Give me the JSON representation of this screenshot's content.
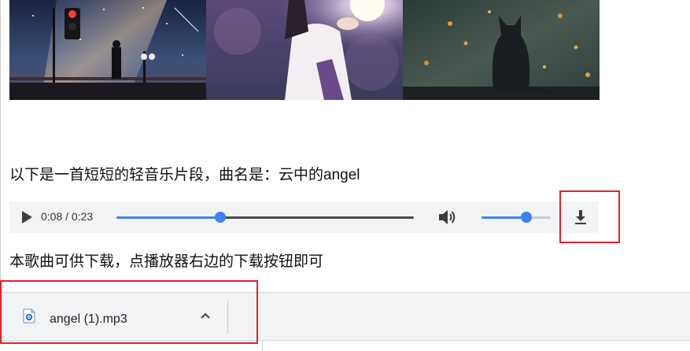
{
  "images": [
    {
      "icon": "starry-night-railway-crossing-image"
    },
    {
      "icon": "girl-holding-lamp-image"
    },
    {
      "icon": "cat-silhouette-window-image"
    }
  ],
  "paragraph_intro": "以下是一首短短的轻音乐片段，曲名是：云中的angel",
  "player": {
    "time": "0:08 / 0:23",
    "progress_fraction": 0.35,
    "volume_fraction": 0.65
  },
  "paragraph_download": "本歌曲可供下载，点播放器右边的下载按钮即可",
  "download_shelf": {
    "file_name": "angel (1).mp3",
    "file_icon": "audio-file-icon"
  },
  "colors": {
    "accent": "#3b82f6",
    "highlight": "#e3202a",
    "player_bg": "#f1f3f4",
    "shelf_bg": "#f1f3f4"
  }
}
